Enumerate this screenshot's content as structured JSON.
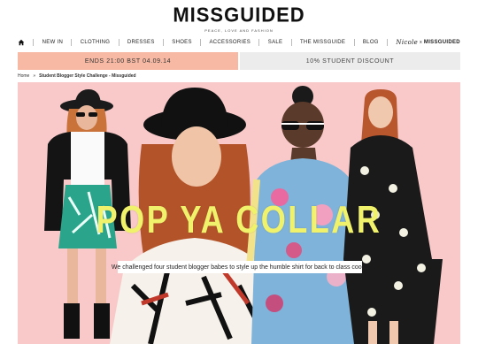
{
  "header": {
    "logo": "MISSGUIDED",
    "tagline": "PEACE, LOVE AND FASHION"
  },
  "nav": {
    "items": [
      {
        "label": "NEW IN"
      },
      {
        "label": "CLOTHING"
      },
      {
        "label": "DRESSES"
      },
      {
        "label": "SHOES"
      },
      {
        "label": "ACCESSORIES"
      },
      {
        "label": "SALE"
      },
      {
        "label": "THE MISSGUIDE"
      },
      {
        "label": "BLOG"
      }
    ],
    "collab": {
      "script": "Nicole",
      "joiner": "x",
      "brand": "MISSGUIDED"
    }
  },
  "promos": {
    "left": "ENDS 21:00 BST 04.09.14",
    "right": "10% STUDENT DISCOUNT"
  },
  "breadcrumb": {
    "home": "Home",
    "separator": "»",
    "current": "Student Blogger Style Challenge - Missguided"
  },
  "hero": {
    "headline": "POP YA COLLAR",
    "caption": "We challenged four student blogger babes to style up the humble shirt for back to class cool...",
    "colors": {
      "background": "#f9c9c9",
      "headline": "#f1f26b"
    }
  }
}
